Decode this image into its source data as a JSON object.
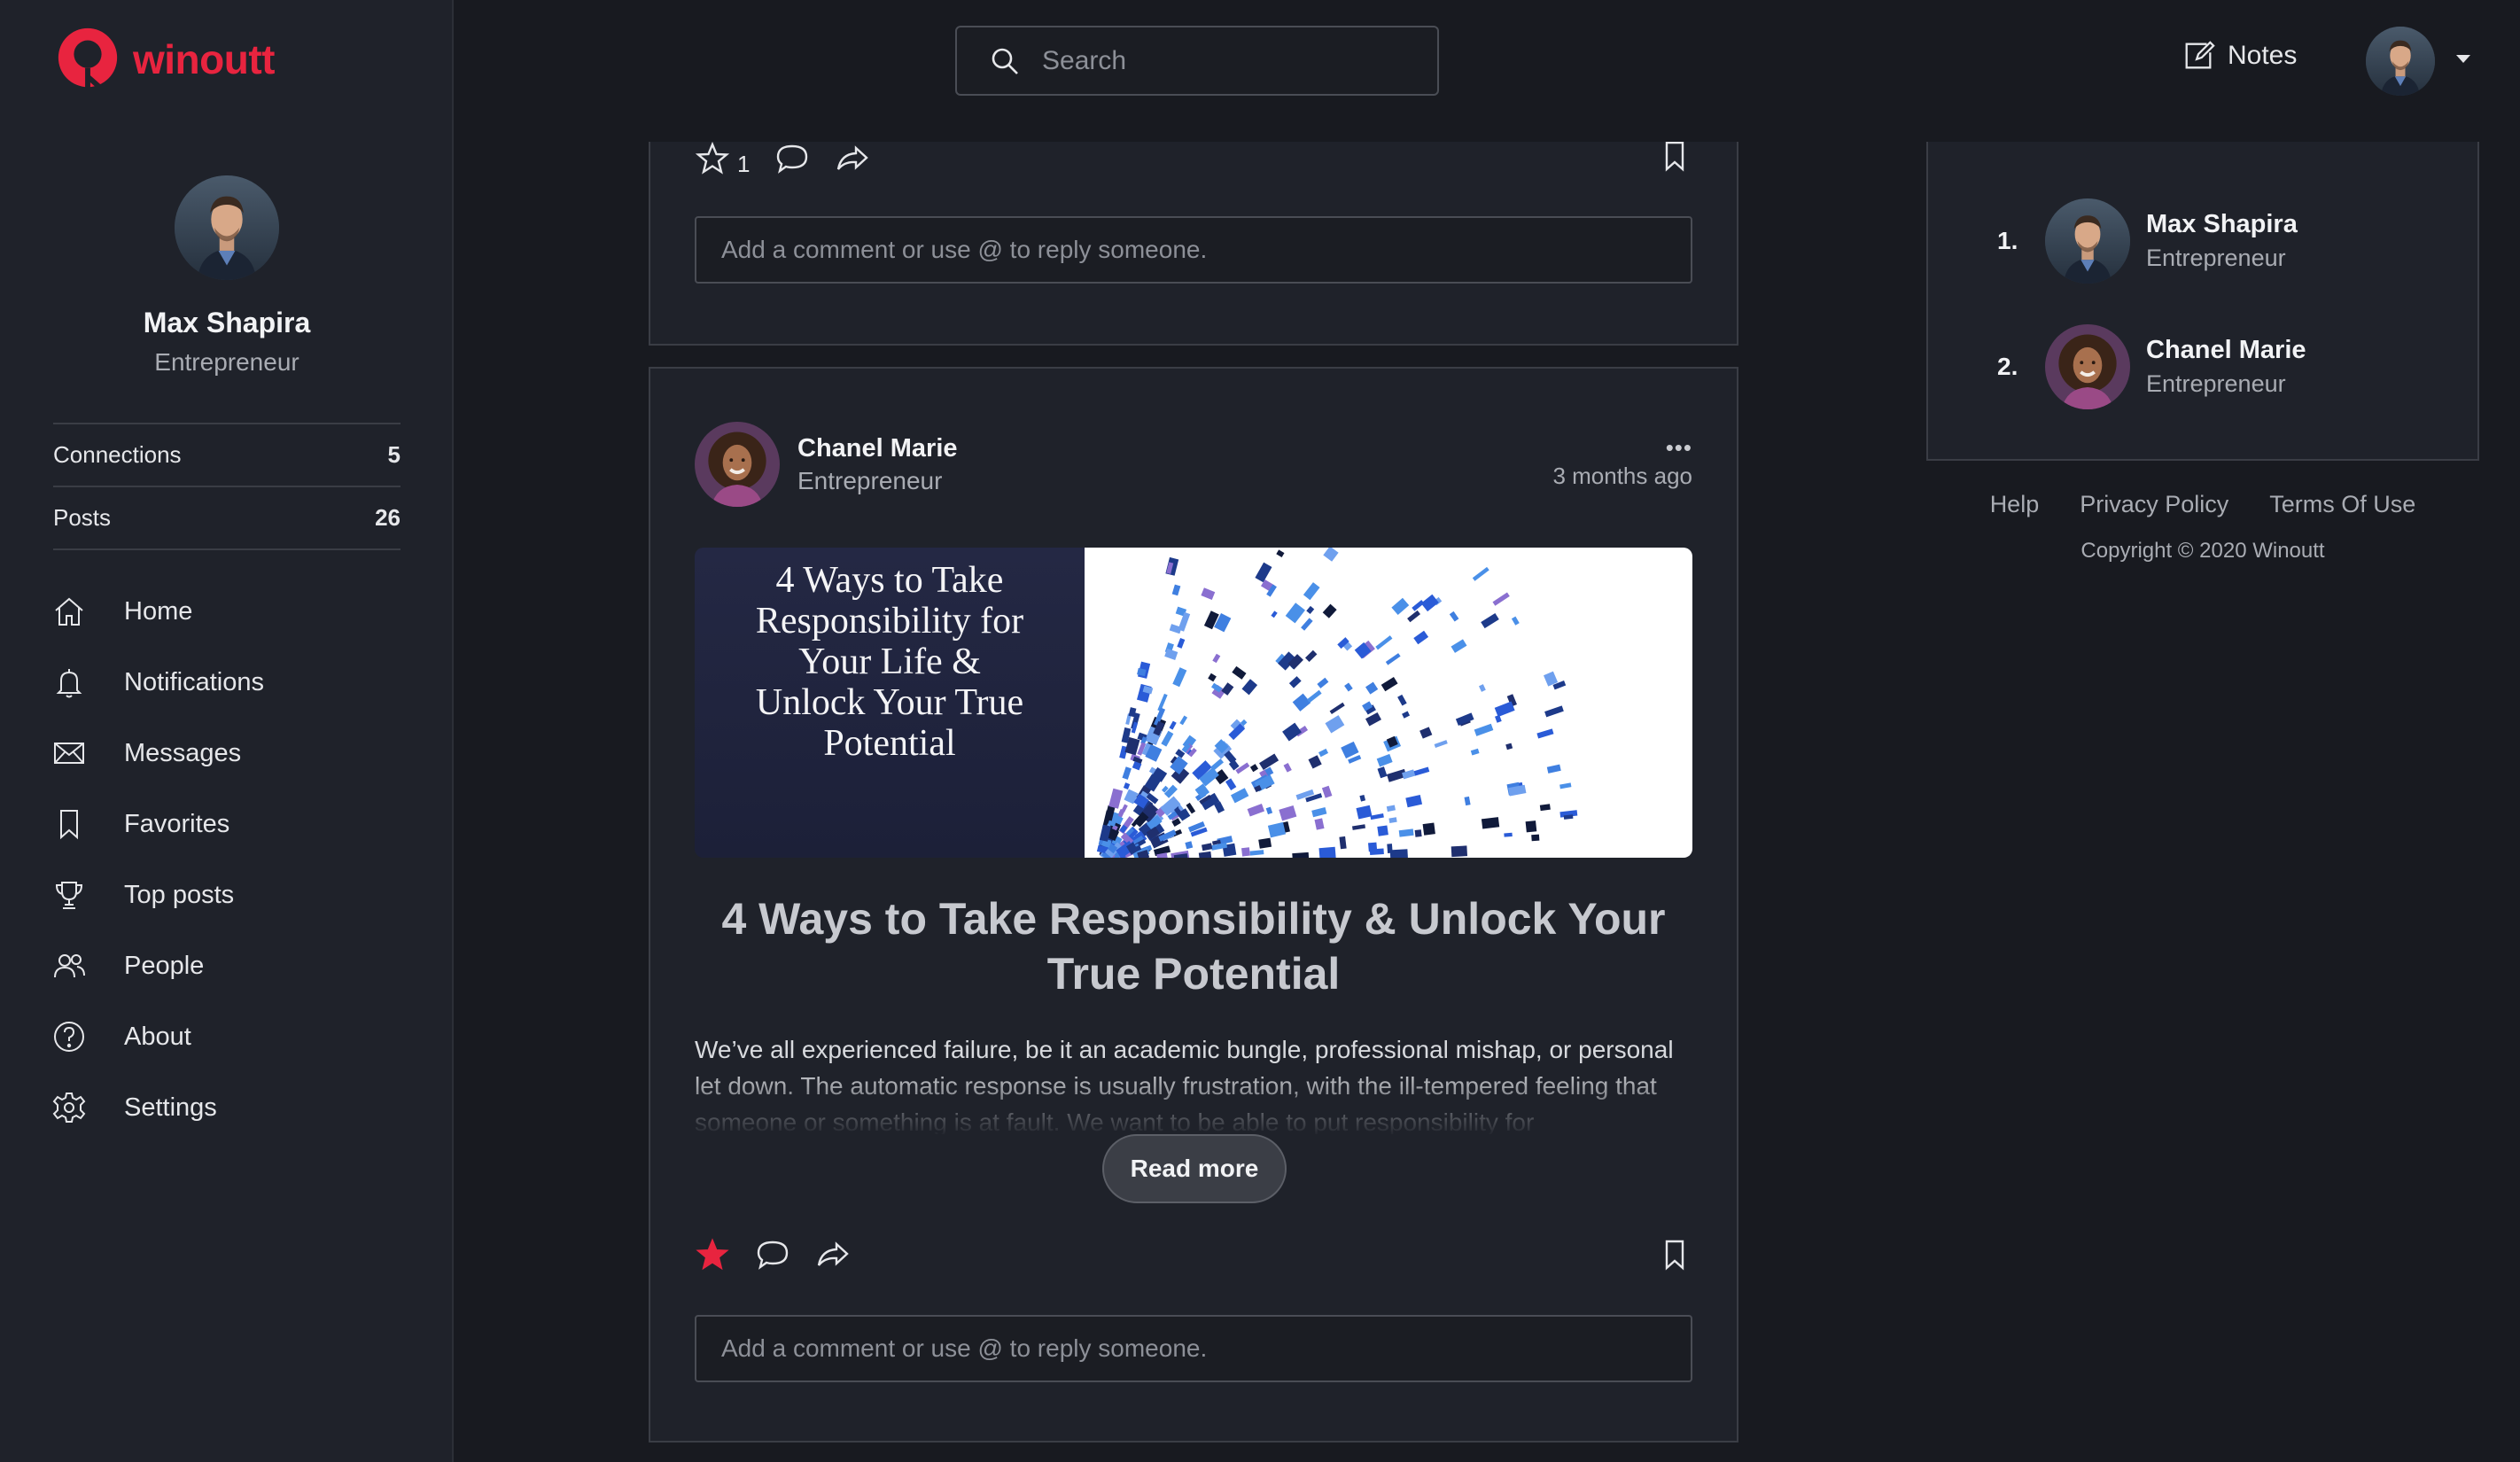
{
  "brand": {
    "name": "winoutt",
    "color": "#e8243f"
  },
  "search": {
    "placeholder": "Search",
    "icon": "search-icon"
  },
  "header": {
    "notes_label": "Notes"
  },
  "profile": {
    "name": "Max Shapira",
    "role": "Entrepreneur"
  },
  "stats": [
    {
      "label": "Connections",
      "value": "5"
    },
    {
      "label": "Posts",
      "value": "26"
    }
  ],
  "nav": [
    {
      "label": "Home",
      "icon": "home-icon"
    },
    {
      "label": "Notifications",
      "icon": "bell-icon"
    },
    {
      "label": "Messages",
      "icon": "envelope-icon"
    },
    {
      "label": "Favorites",
      "icon": "bookmark-icon"
    },
    {
      "label": "Top posts",
      "icon": "trophy-icon"
    },
    {
      "label": "People",
      "icon": "people-icon"
    },
    {
      "label": "About",
      "icon": "question-icon"
    },
    {
      "label": "Settings",
      "icon": "gear-icon"
    }
  ],
  "feed": {
    "previous_post": {
      "star_count": "1",
      "comment_placeholder": "Add a comment or use @ to reply someone."
    },
    "post": {
      "author_name": "Chanel Marie",
      "author_role": "Entrepreneur",
      "time": "3 months ago",
      "more_label": "•••",
      "image_caption": "4 Ways to Take Responsibility for Your Life & Unlock Your True Potential",
      "title": "4 Ways to Take Responsibility & Unlock Your True Potential",
      "excerpt": "We’ve all experienced failure, be it an academic bungle, professional mishap, or personal let down. The automatic response is usually frustration, with the ill-tempered feeling that someone or something is at fault. We want to be able to put responsibility for",
      "read_more_label": "Read more",
      "starred": true,
      "comment_placeholder": "Add a comment or use @ to reply someone."
    }
  },
  "top_people": [
    {
      "rank": "1.",
      "name": "Max Shapira",
      "role": "Entrepreneur"
    },
    {
      "rank": "2.",
      "name": "Chanel Marie",
      "role": "Entrepreneur"
    }
  ],
  "footer": {
    "links": [
      "Help",
      "Privacy Policy",
      "Terms Of Use"
    ],
    "copyright": "Copyright © 2020 Winoutt"
  }
}
